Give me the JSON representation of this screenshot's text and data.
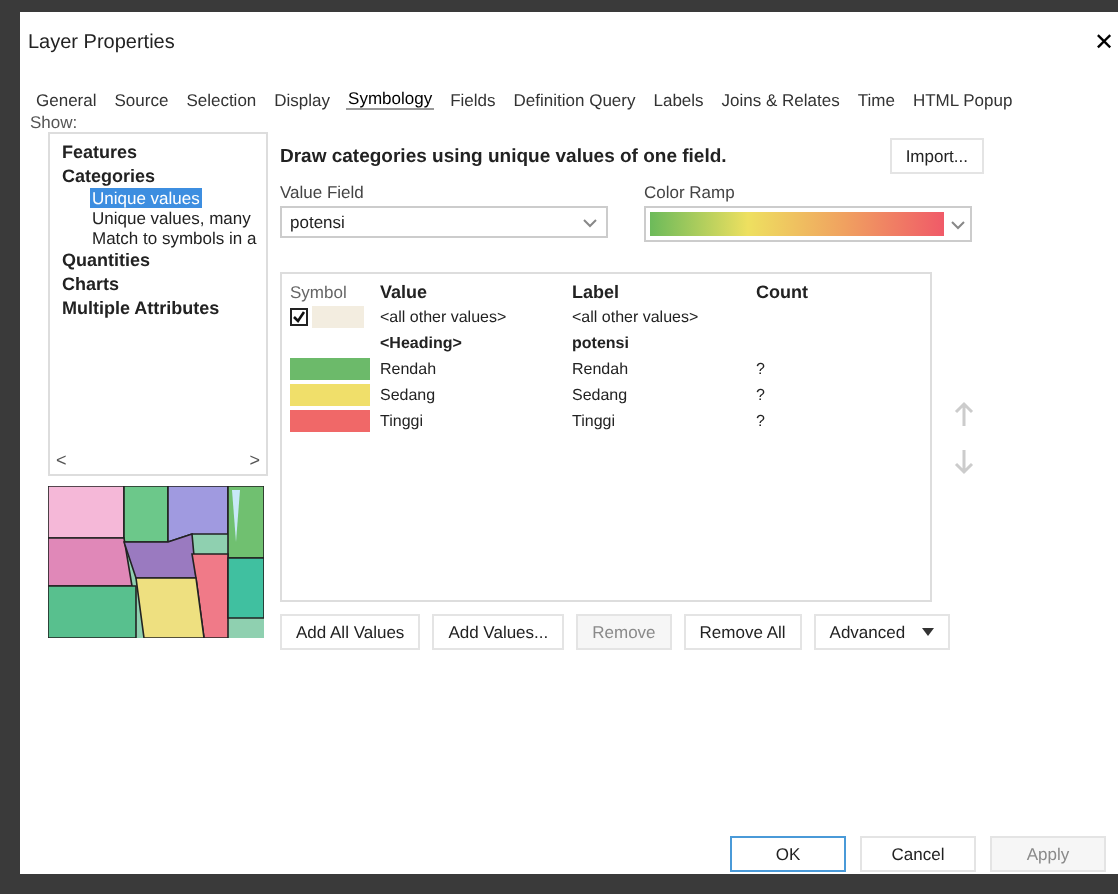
{
  "window": {
    "title": "Layer Properties",
    "close": "✕"
  },
  "tabs": [
    {
      "label": "General",
      "selected": false
    },
    {
      "label": "Source",
      "selected": false
    },
    {
      "label": "Selection",
      "selected": false
    },
    {
      "label": "Display",
      "selected": false
    },
    {
      "label": "Symbology",
      "selected": true
    },
    {
      "label": "Fields",
      "selected": false
    },
    {
      "label": "Definition Query",
      "selected": false
    },
    {
      "label": "Labels",
      "selected": false
    },
    {
      "label": "Joins & Relates",
      "selected": false
    },
    {
      "label": "Time",
      "selected": false
    },
    {
      "label": "HTML Popup",
      "selected": false
    }
  ],
  "show": {
    "label": "Show:",
    "items": [
      {
        "label": "Features",
        "selected": false
      },
      {
        "label": "Categories",
        "selected": false,
        "children": [
          {
            "label": "Unique values",
            "selected": true
          },
          {
            "label": "Unique values, many",
            "selected": false
          },
          {
            "label": "Match to symbols in a",
            "selected": false
          }
        ]
      },
      {
        "label": "Quantities",
        "selected": false
      },
      {
        "label": "Charts",
        "selected": false
      },
      {
        "label": "Multiple Attributes",
        "selected": false
      }
    ],
    "scroll_left": "<",
    "scroll_right": ">"
  },
  "heading": "Draw categories using unique values of one field.",
  "import_button": "Import...",
  "value_field": {
    "label": "Value Field",
    "value": "potensi"
  },
  "color_ramp": {
    "label": "Color Ramp"
  },
  "table": {
    "columns": [
      "Symbol",
      "Value",
      "Label",
      "Count"
    ],
    "rows": [
      {
        "kind": "other",
        "checked": true,
        "color": "#f3ede0",
        "value": "<all other values>",
        "label": "<all other values>",
        "count": ""
      },
      {
        "kind": "heading",
        "value": "<Heading>",
        "label": "potensi",
        "count": ""
      },
      {
        "kind": "class",
        "color": "#6cba6a",
        "value": "Rendah",
        "label": "Rendah",
        "count": "?"
      },
      {
        "kind": "class",
        "color": "#f0df6a",
        "value": "Sedang",
        "label": "Sedang",
        "count": "?"
      },
      {
        "kind": "class",
        "color": "#f06868",
        "value": "Tinggi",
        "label": "Tinggi",
        "count": "?"
      }
    ]
  },
  "buttons": [
    {
      "label": "Add All Values",
      "disabled": false
    },
    {
      "label": "Add Values...",
      "disabled": false
    },
    {
      "label": "Remove",
      "disabled": true
    },
    {
      "label": "Remove All",
      "disabled": false
    },
    {
      "label": "Advanced",
      "disabled": false,
      "menu": true
    }
  ],
  "dialog_buttons": [
    {
      "label": "OK",
      "disabled": false,
      "default": true
    },
    {
      "label": "Cancel",
      "disabled": false,
      "default": false
    },
    {
      "label": "Apply",
      "disabled": true,
      "default": false
    }
  ]
}
